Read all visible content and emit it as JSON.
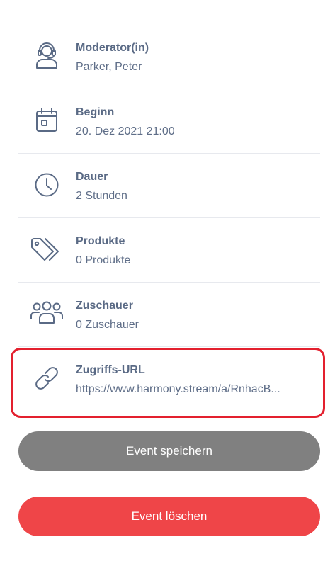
{
  "details": {
    "items": [
      {
        "icon": "moderator-headset-icon",
        "label": "Moderator(in)",
        "value": "Parker, Peter"
      },
      {
        "icon": "calendar-icon",
        "label": "Beginn",
        "value": "20. Dez 2021 21:00"
      },
      {
        "icon": "clock-icon",
        "label": "Dauer",
        "value": "2 Stunden"
      },
      {
        "icon": "tags-icon",
        "label": "Produkte",
        "value": "0 Produkte"
      },
      {
        "icon": "group-icon",
        "label": "Zuschauer",
        "value": "0 Zuschauer"
      },
      {
        "icon": "link-icon",
        "label": "Zugriffs-URL",
        "value": "https://www.harmony.stream/a/RnhacB..."
      }
    ]
  },
  "actions": {
    "save_label": "Event speichern",
    "delete_label": "Event löschen"
  },
  "colors": {
    "icon": "#5a6a85",
    "text": "#5a6a85",
    "divider": "#e7e9ee",
    "highlight": "#e3202e",
    "save_button": "#808080",
    "delete_button": "#ef4548"
  }
}
